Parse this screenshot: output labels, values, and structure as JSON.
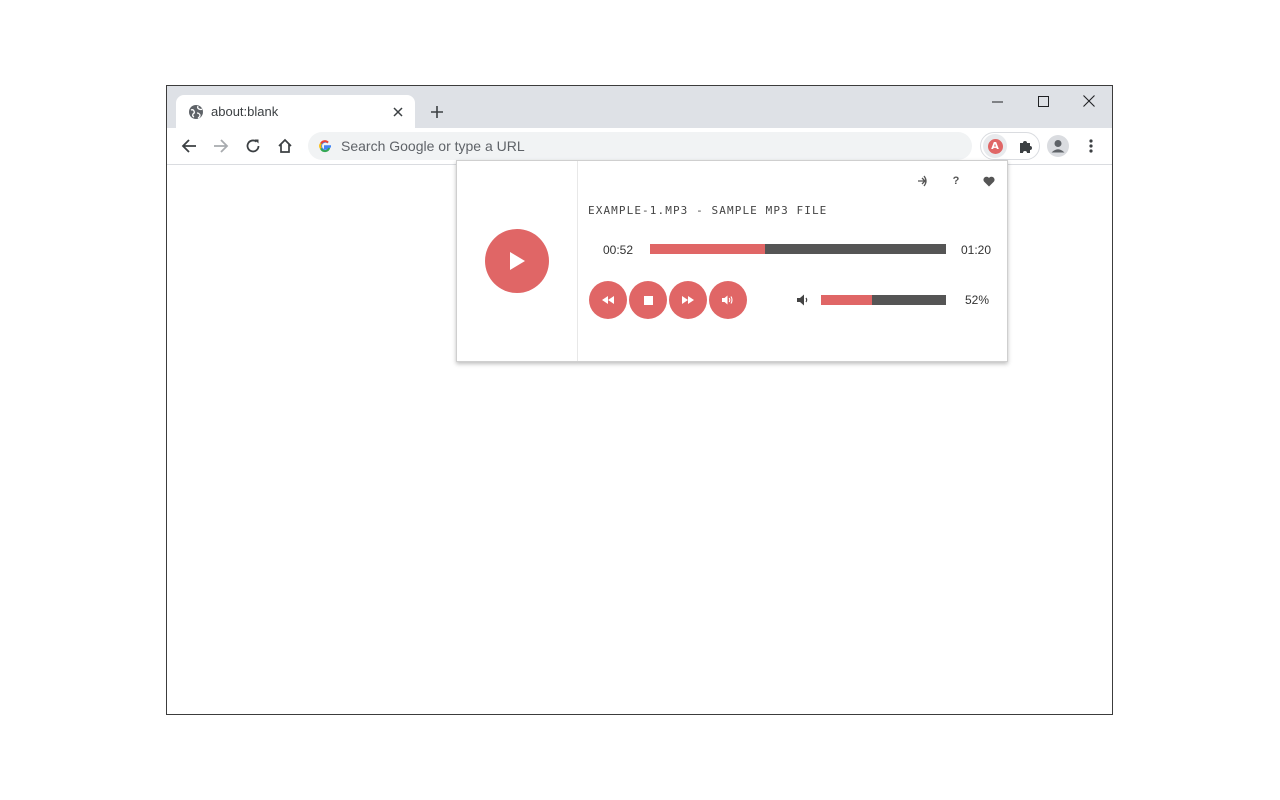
{
  "browser": {
    "tab": {
      "title": "about:blank",
      "favicon": "globe-icon"
    },
    "omnibox": {
      "placeholder": "Search Google or type a URL"
    }
  },
  "player": {
    "track_title": "EXAMPLE-1.MP3 - SAMPLE MP3 FILE",
    "current_time": "00:52",
    "duration": "01:20",
    "progress_fraction": 0.39,
    "volume_label": "52%",
    "volume_fraction": 0.41
  },
  "colors": {
    "accent": "#e06666",
    "track": "#555555",
    "chrome_bar": "#dee1e6"
  }
}
